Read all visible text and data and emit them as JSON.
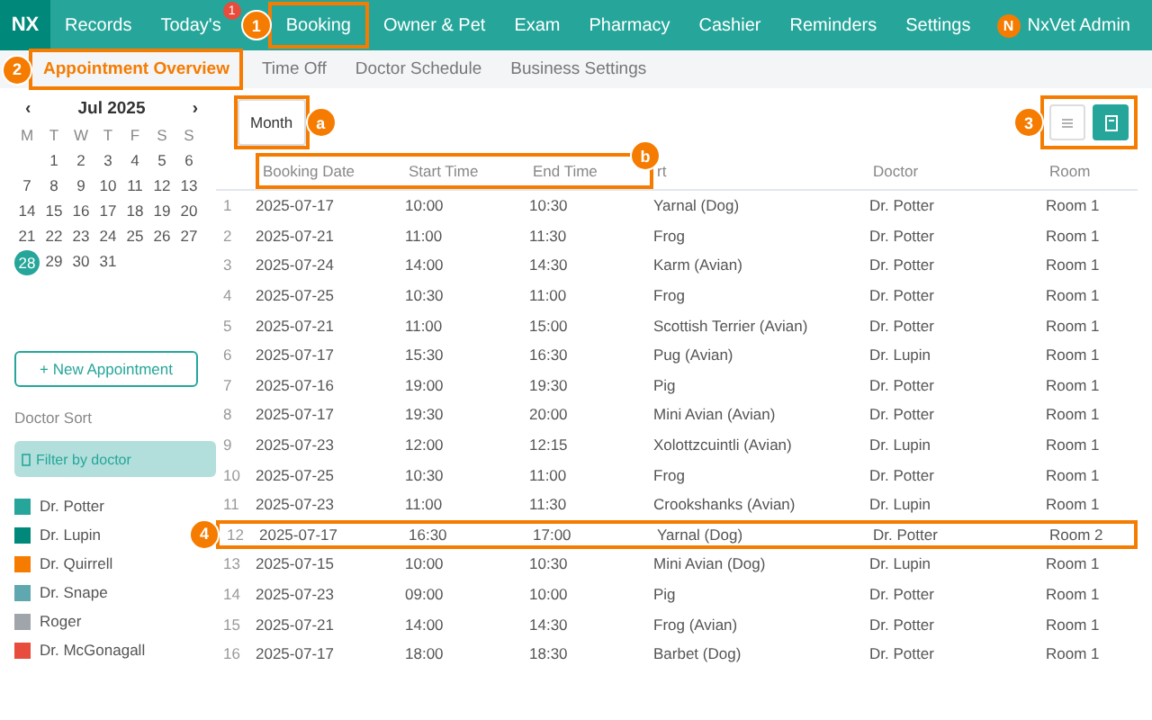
{
  "nav": {
    "logo": "NX",
    "items": [
      {
        "label": "Records"
      },
      {
        "label": "Today's",
        "badge": "1"
      },
      {
        "label": "Booking",
        "callout": "1"
      },
      {
        "label": "Owner & Pet"
      },
      {
        "label": "Exam"
      },
      {
        "label": "Pharmacy"
      },
      {
        "label": "Cashier"
      },
      {
        "label": "Reminders"
      },
      {
        "label": "Settings"
      }
    ],
    "user": {
      "initial": "N",
      "name": "NxVet Admin"
    }
  },
  "subnav": [
    {
      "label": "Appointment Overview",
      "selected": true,
      "callout": "2"
    },
    {
      "label": "Time Off",
      "selected": false
    },
    {
      "label": "Doctor Schedule",
      "selected": false
    },
    {
      "label": "Business Settings",
      "selected": false
    }
  ],
  "calendar": {
    "prev": "‹",
    "month": "Jul 2025",
    "next": "›",
    "weekdays": [
      "M",
      "T",
      "W",
      "T",
      "F",
      "S",
      "S"
    ],
    "weeks": [
      [
        {
          "day": "1",
          "selected": false
        },
        {
          "day": "2",
          "selected": false
        },
        {
          "day": "3",
          "selected": false
        },
        {
          "day": "4",
          "selected": false
        },
        {
          "day": "5",
          "selected": false
        },
        {
          "day": "6",
          "selected": false
        }
      ],
      [
        {
          "day": "7",
          "selected": false
        },
        {
          "day": "8",
          "selected": false
        },
        {
          "day": "9",
          "selected": false
        },
        {
          "day": "10",
          "selected": false
        },
        {
          "day": "11",
          "selected": false
        },
        {
          "day": "12",
          "selected": false
        },
        {
          "day": "13",
          "selected": false
        }
      ],
      [
        {
          "day": "14",
          "selected": false
        },
        {
          "day": "15",
          "selected": false
        },
        {
          "day": "16",
          "selected": false
        },
        {
          "day": "17",
          "selected": false
        },
        {
          "day": "18",
          "selected": false
        },
        {
          "day": "19",
          "selected": false
        },
        {
          "day": "20",
          "selected": false
        }
      ],
      [
        {
          "day": "21",
          "selected": false
        },
        {
          "day": "22",
          "selected": false
        },
        {
          "day": "23",
          "selected": false
        },
        {
          "day": "24",
          "selected": false
        },
        {
          "day": "25",
          "selected": false
        },
        {
          "day": "26",
          "selected": false
        },
        {
          "day": "27",
          "selected": false
        }
      ],
      [
        {
          "day": "28",
          "selected": true
        },
        {
          "day": "29",
          "selected": false
        },
        {
          "day": "30",
          "selected": false
        },
        {
          "day": "31",
          "selected": false
        }
      ]
    ]
  },
  "new_appointment": "+ New Appointment",
  "doctor_sort": {
    "title": "Doctor Sort",
    "filter": "Filter by doctor",
    "doctors": [
      {
        "name": "Dr. Potter",
        "color": "#26a69a"
      },
      {
        "name": "Dr. Lupin",
        "color": "#00897b"
      },
      {
        "name": "Dr. Quirrell",
        "color": "#f57c00"
      },
      {
        "name": "Dr. Snape",
        "color": "#5fa8b0"
      },
      {
        "name": "Roger",
        "color": "#a0a4ab"
      },
      {
        "name": "Dr. McGonagall",
        "color": "#e74c3c"
      }
    ]
  },
  "toolbar": {
    "view_button": {
      "label": "Month",
      "callout": "a"
    },
    "view_toggle": {
      "callout": "3",
      "options": [
        {
          "kind": "list",
          "selected": false
        },
        {
          "kind": "calendar",
          "selected": true
        }
      ]
    }
  },
  "table": {
    "header_callout": "b",
    "columns": [
      {
        "label": "Booking Date",
        "highlighted": true
      },
      {
        "label": "Start Time",
        "highlighted": true
      },
      {
        "label": "End Time",
        "highlighted": true
      },
      {
        "label": "rt",
        "highlighted": false
      },
      {
        "label": "Doctor",
        "highlighted": false
      },
      {
        "label": "Room",
        "highlighted": false
      }
    ],
    "rows": [
      {
        "number": "1",
        "cells": [
          "2025-07-17",
          "10:00",
          "10:30",
          "Yarnal (Dog)",
          "Dr. Potter",
          "Room 1"
        ]
      },
      {
        "number": "2",
        "cells": [
          "2025-07-21",
          "11:00",
          "11:30",
          "Frog",
          "Dr. Potter",
          "Room 1"
        ]
      },
      {
        "number": "3",
        "cells": [
          "2025-07-24",
          "14:00",
          "14:30",
          "Karm (Avian)",
          "Dr. Potter",
          "Room 1"
        ]
      },
      {
        "number": "4",
        "cells": [
          "2025-07-25",
          "10:30",
          "11:00",
          "Frog",
          "Dr. Potter",
          "Room 1"
        ]
      },
      {
        "number": "5",
        "cells": [
          "2025-07-21",
          "11:00",
          "15:00",
          "Scottish Terrier (Avian)",
          "Dr. Potter",
          "Room 1"
        ]
      },
      {
        "number": "6",
        "cells": [
          "2025-07-17",
          "15:30",
          "16:30",
          "Pug (Avian)",
          "Dr. Lupin",
          "Room 1"
        ]
      },
      {
        "number": "7",
        "cells": [
          "2025-07-16",
          "19:00",
          "19:30",
          "Pig",
          "Dr. Potter",
          "Room 1"
        ]
      },
      {
        "number": "8",
        "cells": [
          "2025-07-17",
          "19:30",
          "20:00",
          "Mini Avian (Avian)",
          "Dr. Potter",
          "Room 1"
        ]
      },
      {
        "number": "9",
        "cells": [
          "2025-07-23",
          "12:00",
          "12:15",
          "Xolottzcuintli (Avian)",
          "Dr. Lupin",
          "Room 1"
        ]
      },
      {
        "number": "10",
        "cells": [
          "2025-07-25",
          "10:30",
          "11:00",
          "Frog",
          "Dr. Potter",
          "Room 1"
        ]
      },
      {
        "number": "11",
        "cells": [
          "2025-07-23",
          "11:00",
          "11:30",
          "Crookshanks (Avian)",
          "Dr. Lupin",
          "Room 1"
        ]
      },
      {
        "number": "12",
        "cells": [
          "2025-07-17",
          "16:30",
          "17:00",
          "Yarnal (Dog)",
          "Dr. Potter",
          "Room 2"
        ],
        "callout": "4"
      },
      {
        "number": "13",
        "cells": [
          "2025-07-15",
          "10:00",
          "10:30",
          "Mini Avian (Dog)",
          "Dr. Lupin",
          "Room 1"
        ]
      },
      {
        "number": "14",
        "cells": [
          "2025-07-23",
          "09:00",
          "10:00",
          "Pig",
          "Dr. Potter",
          "Room 1"
        ]
      },
      {
        "number": "15",
        "cells": [
          "2025-07-21",
          "14:00",
          "14:30",
          "Frog (Avian)",
          "Dr. Potter",
          "Room 1"
        ]
      },
      {
        "number": "16",
        "cells": [
          "2025-07-17",
          "18:00",
          "18:30",
          "Barbet (Dog)",
          "Dr. Potter",
          "Room 1"
        ]
      }
    ]
  }
}
